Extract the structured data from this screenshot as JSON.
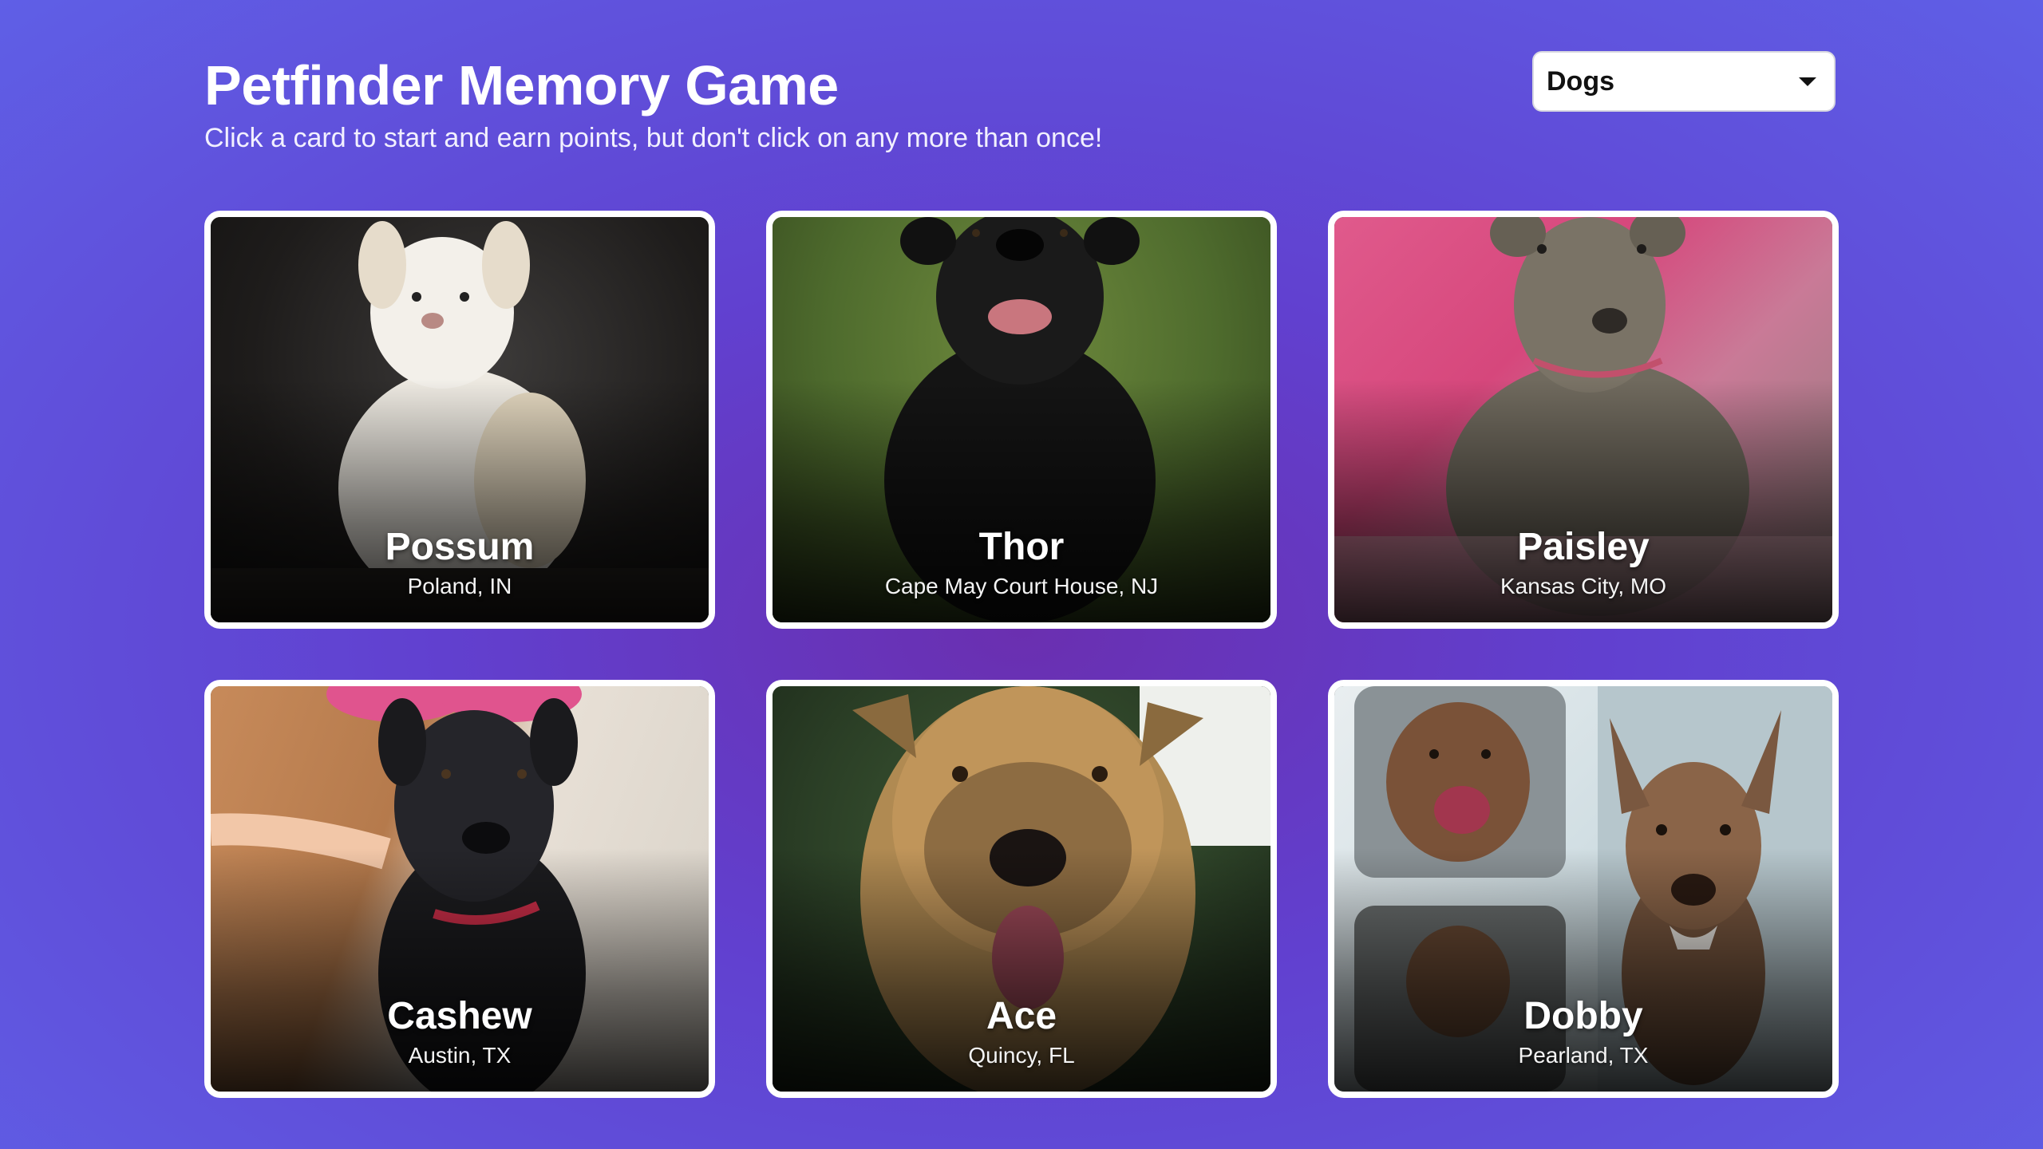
{
  "header": {
    "title": "Petfinder Memory Game",
    "subtitle": "Click a card to start and earn points, but don't click on any more than once!"
  },
  "animal_select": {
    "selected": "Dogs",
    "icon": "chevron-down-icon"
  },
  "cards": [
    {
      "name": "Possum",
      "location": "Poland, IN"
    },
    {
      "name": "Thor",
      "location": "Cape May Court House, NJ"
    },
    {
      "name": "Paisley",
      "location": "Kansas City, MO"
    },
    {
      "name": "Cashew",
      "location": "Austin, TX"
    },
    {
      "name": "Ace",
      "location": "Quincy, FL"
    },
    {
      "name": "Dobby",
      "location": "Pearland, TX"
    }
  ],
  "colors": {
    "background_start": "#6a2fb0",
    "background_end": "#5f5fe6",
    "card_border": "#ffffff",
    "text": "#ffffff"
  }
}
